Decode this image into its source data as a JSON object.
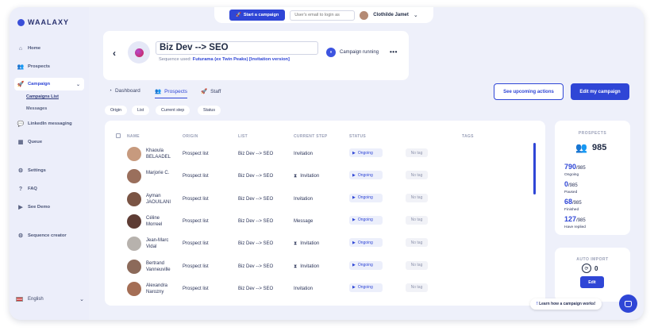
{
  "brand": {
    "name": "WAALAXY"
  },
  "sidebar": {
    "items": [
      {
        "label": "Home",
        "icon": "home-icon"
      },
      {
        "label": "Prospects",
        "icon": "users-icon"
      },
      {
        "label": "Campaign",
        "icon": "rocket-icon"
      },
      {
        "label": "LinkedIn messaging",
        "icon": "message-icon"
      },
      {
        "label": "Queue",
        "icon": "calendar-icon"
      },
      {
        "label": "Settings",
        "icon": "gear-icon"
      },
      {
        "label": "FAQ",
        "icon": "help-icon"
      },
      {
        "label": "See Demo",
        "icon": "play-icon"
      },
      {
        "label": "Sequence creator",
        "icon": "gear-icon"
      }
    ],
    "subitems": [
      "Campaigns List",
      "Messages"
    ],
    "language": "English"
  },
  "topbar": {
    "start_label": "Start a campaign",
    "email_placeholder": "User's email to login as",
    "user_name": "Clothilde Jamet"
  },
  "campaign": {
    "name": "Biz Dev --> SEO",
    "sequence_prefix": "Sequence used:",
    "sequence_name": "Futurama (ex Twin Peaks) [Invitation version]",
    "status": "Campaign running"
  },
  "tabs": [
    "Dashboard",
    "Prospects",
    "Staff"
  ],
  "filters": [
    "Origin",
    "List",
    "Current step",
    "Status"
  ],
  "actions": {
    "upcoming": "See upcoming actions",
    "edit": "Edit my campaign"
  },
  "table": {
    "columns": [
      "NAME",
      "ORIGIN",
      "LIST",
      "CURRENT STEP",
      "STATUS",
      "TAGS"
    ],
    "rows": [
      {
        "first": "Khaoula",
        "last": "BELAADEL",
        "origin": "Prospect list",
        "list": "Biz Dev --> SEO",
        "step": "Invitation",
        "status": "Ongoing",
        "tag": "No tag",
        "hourglass": false
      },
      {
        "first": "Marjorie C.",
        "last": "",
        "origin": "Prospect list",
        "list": "Biz Dev --> SEO",
        "step": "Invitation",
        "status": "Ongoing",
        "tag": "No tag",
        "hourglass": true
      },
      {
        "first": "Ayman",
        "last": "JAOUILANI",
        "origin": "Prospect list",
        "list": "Biz Dev --> SEO",
        "step": "Invitation",
        "status": "Ongoing",
        "tag": "No tag",
        "hourglass": false
      },
      {
        "first": "Céline",
        "last": "Morreel",
        "origin": "Prospect list",
        "list": "Biz Dev --> SEO",
        "step": "Message",
        "status": "Ongoing",
        "tag": "No tag",
        "hourglass": false
      },
      {
        "first": "Jean-Marc",
        "last": "Vidal",
        "origin": "Prospect list",
        "list": "Biz Dev --> SEO",
        "step": "Invitation",
        "status": "Ongoing",
        "tag": "No tag",
        "hourglass": true
      },
      {
        "first": "Bertrand",
        "last": "Vanneuville",
        "origin": "Prospect list",
        "list": "Biz Dev --> SEO",
        "step": "Invitation",
        "status": "Ongoing",
        "tag": "No tag",
        "hourglass": true
      },
      {
        "first": "Alexandra",
        "last": "Narozny",
        "origin": "Prospect list",
        "list": "Biz Dev --> SEO",
        "step": "Invitation",
        "status": "Ongoing",
        "tag": "No tag",
        "hourglass": false
      }
    ]
  },
  "stats": {
    "title": "PROSPECTS",
    "total": "985",
    "items": [
      {
        "value": "790",
        "of": "/985",
        "label": "Ongoing"
      },
      {
        "value": "0",
        "of": "/985",
        "label": "Paused"
      },
      {
        "value": "68",
        "of": "/985",
        "label": "Finished"
      },
      {
        "value": "127",
        "of": "/985",
        "label": "Have replied"
      }
    ]
  },
  "auto_import": {
    "title": "AUTO IMPORT",
    "count": "0",
    "button": "Edit"
  },
  "help": {
    "learn": "Learn how a campaign works!"
  },
  "colors": {
    "accent": "#2f46d6",
    "background": "#eef0fa"
  }
}
